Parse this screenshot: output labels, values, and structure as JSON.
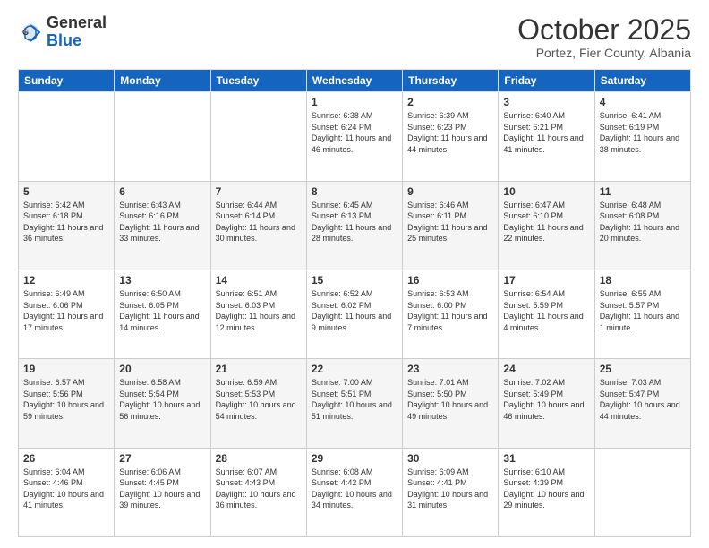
{
  "header": {
    "logo_general": "General",
    "logo_blue": "Blue",
    "month_title": "October 2025",
    "subtitle": "Portez, Fier County, Albania"
  },
  "days_of_week": [
    "Sunday",
    "Monday",
    "Tuesday",
    "Wednesday",
    "Thursday",
    "Friday",
    "Saturday"
  ],
  "weeks": [
    [
      {
        "day": "",
        "info": ""
      },
      {
        "day": "",
        "info": ""
      },
      {
        "day": "",
        "info": ""
      },
      {
        "day": "1",
        "info": "Sunrise: 6:38 AM\nSunset: 6:24 PM\nDaylight: 11 hours and 46 minutes."
      },
      {
        "day": "2",
        "info": "Sunrise: 6:39 AM\nSunset: 6:23 PM\nDaylight: 11 hours and 44 minutes."
      },
      {
        "day": "3",
        "info": "Sunrise: 6:40 AM\nSunset: 6:21 PM\nDaylight: 11 hours and 41 minutes."
      },
      {
        "day": "4",
        "info": "Sunrise: 6:41 AM\nSunset: 6:19 PM\nDaylight: 11 hours and 38 minutes."
      }
    ],
    [
      {
        "day": "5",
        "info": "Sunrise: 6:42 AM\nSunset: 6:18 PM\nDaylight: 11 hours and 36 minutes."
      },
      {
        "day": "6",
        "info": "Sunrise: 6:43 AM\nSunset: 6:16 PM\nDaylight: 11 hours and 33 minutes."
      },
      {
        "day": "7",
        "info": "Sunrise: 6:44 AM\nSunset: 6:14 PM\nDaylight: 11 hours and 30 minutes."
      },
      {
        "day": "8",
        "info": "Sunrise: 6:45 AM\nSunset: 6:13 PM\nDaylight: 11 hours and 28 minutes."
      },
      {
        "day": "9",
        "info": "Sunrise: 6:46 AM\nSunset: 6:11 PM\nDaylight: 11 hours and 25 minutes."
      },
      {
        "day": "10",
        "info": "Sunrise: 6:47 AM\nSunset: 6:10 PM\nDaylight: 11 hours and 22 minutes."
      },
      {
        "day": "11",
        "info": "Sunrise: 6:48 AM\nSunset: 6:08 PM\nDaylight: 11 hours and 20 minutes."
      }
    ],
    [
      {
        "day": "12",
        "info": "Sunrise: 6:49 AM\nSunset: 6:06 PM\nDaylight: 11 hours and 17 minutes."
      },
      {
        "day": "13",
        "info": "Sunrise: 6:50 AM\nSunset: 6:05 PM\nDaylight: 11 hours and 14 minutes."
      },
      {
        "day": "14",
        "info": "Sunrise: 6:51 AM\nSunset: 6:03 PM\nDaylight: 11 hours and 12 minutes."
      },
      {
        "day": "15",
        "info": "Sunrise: 6:52 AM\nSunset: 6:02 PM\nDaylight: 11 hours and 9 minutes."
      },
      {
        "day": "16",
        "info": "Sunrise: 6:53 AM\nSunset: 6:00 PM\nDaylight: 11 hours and 7 minutes."
      },
      {
        "day": "17",
        "info": "Sunrise: 6:54 AM\nSunset: 5:59 PM\nDaylight: 11 hours and 4 minutes."
      },
      {
        "day": "18",
        "info": "Sunrise: 6:55 AM\nSunset: 5:57 PM\nDaylight: 11 hours and 1 minute."
      }
    ],
    [
      {
        "day": "19",
        "info": "Sunrise: 6:57 AM\nSunset: 5:56 PM\nDaylight: 10 hours and 59 minutes."
      },
      {
        "day": "20",
        "info": "Sunrise: 6:58 AM\nSunset: 5:54 PM\nDaylight: 10 hours and 56 minutes."
      },
      {
        "day": "21",
        "info": "Sunrise: 6:59 AM\nSunset: 5:53 PM\nDaylight: 10 hours and 54 minutes."
      },
      {
        "day": "22",
        "info": "Sunrise: 7:00 AM\nSunset: 5:51 PM\nDaylight: 10 hours and 51 minutes."
      },
      {
        "day": "23",
        "info": "Sunrise: 7:01 AM\nSunset: 5:50 PM\nDaylight: 10 hours and 49 minutes."
      },
      {
        "day": "24",
        "info": "Sunrise: 7:02 AM\nSunset: 5:49 PM\nDaylight: 10 hours and 46 minutes."
      },
      {
        "day": "25",
        "info": "Sunrise: 7:03 AM\nSunset: 5:47 PM\nDaylight: 10 hours and 44 minutes."
      }
    ],
    [
      {
        "day": "26",
        "info": "Sunrise: 6:04 AM\nSunset: 4:46 PM\nDaylight: 10 hours and 41 minutes."
      },
      {
        "day": "27",
        "info": "Sunrise: 6:06 AM\nSunset: 4:45 PM\nDaylight: 10 hours and 39 minutes."
      },
      {
        "day": "28",
        "info": "Sunrise: 6:07 AM\nSunset: 4:43 PM\nDaylight: 10 hours and 36 minutes."
      },
      {
        "day": "29",
        "info": "Sunrise: 6:08 AM\nSunset: 4:42 PM\nDaylight: 10 hours and 34 minutes."
      },
      {
        "day": "30",
        "info": "Sunrise: 6:09 AM\nSunset: 4:41 PM\nDaylight: 10 hours and 31 minutes."
      },
      {
        "day": "31",
        "info": "Sunrise: 6:10 AM\nSunset: 4:39 PM\nDaylight: 10 hours and 29 minutes."
      },
      {
        "day": "",
        "info": ""
      }
    ]
  ]
}
